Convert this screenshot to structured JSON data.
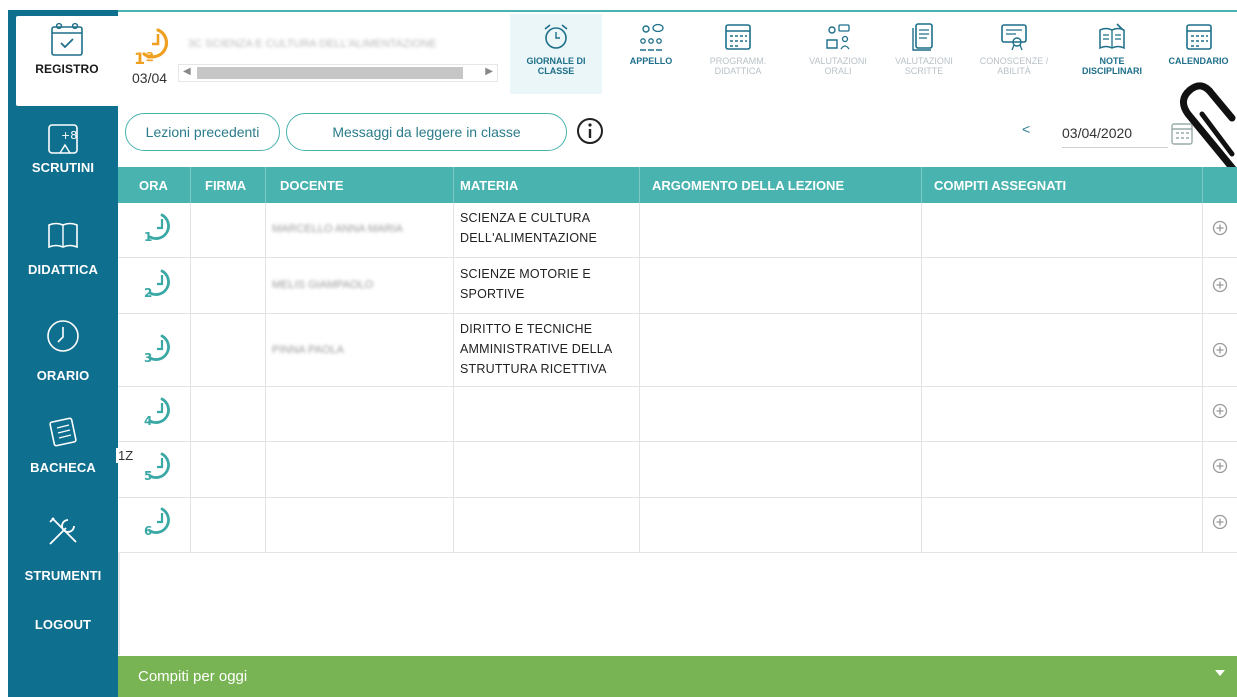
{
  "sidebar": {
    "items": [
      {
        "label": "REGISTRO",
        "icon": "register-calendar-icon"
      },
      {
        "label": "SCRUTINI",
        "icon": "scrutini-grades-icon"
      },
      {
        "label": "DIDATTICA",
        "icon": "open-book-icon"
      },
      {
        "label": "ORARIO",
        "icon": "clock-icon"
      },
      {
        "label": "BACHECA",
        "icon": "notice-board-icon"
      },
      {
        "label": "STRUMENTI",
        "icon": "tools-icon"
      },
      {
        "label": "LOGOUT",
        "icon": ""
      }
    ]
  },
  "header": {
    "hour_badge": "1ª",
    "class_name": "3C SCIENZA E CULTURA DELL'ALIMENTAZIONE",
    "date_short": "03/04"
  },
  "toolbar": {
    "items": [
      {
        "label": "GIORNALE DI CLASSE",
        "icon": "alarm-clock-icon",
        "active": true,
        "muted": false
      },
      {
        "label": "APPELLO",
        "icon": "attendance-icon",
        "active": false,
        "muted": false
      },
      {
        "label": "PROGRAMM. DIDATTICA",
        "icon": "planner-calendar-icon",
        "active": false,
        "muted": true
      },
      {
        "label": "VALUTAZIONI ORALI",
        "icon": "oral-grades-icon",
        "active": false,
        "muted": true
      },
      {
        "label": "VALUTAZIONI SCRITTE",
        "icon": "written-grades-icon",
        "active": false,
        "muted": true
      },
      {
        "label": "CONOSCENZE / ABILITÀ",
        "icon": "skills-certificate-icon",
        "active": false,
        "muted": true
      },
      {
        "label": "NOTE DISCIPLINARI",
        "icon": "disciplinary-notes-icon",
        "active": false,
        "muted": false
      },
      {
        "label": "CALENDARIO",
        "icon": "calendar-icon",
        "active": false,
        "muted": false
      }
    ]
  },
  "actions": {
    "prev_lessons": "Lezioni precedenti",
    "messages": "Messaggi da leggere in classe",
    "date_prev": "<",
    "date_value": "03/04/2020"
  },
  "table": {
    "headers": [
      "ORA",
      "FIRMA",
      "DOCENTE",
      "MATERIA",
      "ARGOMENTO DELLA LEZIONE",
      "COMPITI ASSEGNATI"
    ],
    "rows": [
      {
        "hour": "1",
        "docente": "MARCELLO ANNA MARIA",
        "materia": "SCIENZA E CULTURA DELL'ALIMENTAZIONE"
      },
      {
        "hour": "2",
        "docente": "MELIS GIAMPAOLO",
        "materia": "SCIENZE MOTORIE E SPORTIVE"
      },
      {
        "hour": "3",
        "docente": "PINNA PAOLA",
        "materia": "DIRITTO E TECNICHE AMMINISTRATIVE DELLA STRUTTURA RICETTIVA"
      },
      {
        "hour": "4",
        "docente": "",
        "materia": ""
      },
      {
        "hour": "5",
        "docente": "",
        "materia": ""
      },
      {
        "hour": "6",
        "docente": "",
        "materia": ""
      }
    ],
    "side_note": "1Z"
  },
  "footer": {
    "label": "Compiti per oggi"
  },
  "colors": {
    "sidebar": "#0f6f8f",
    "accent": "#49b3b0",
    "orange": "#f0a020",
    "footer": "#78b453"
  }
}
